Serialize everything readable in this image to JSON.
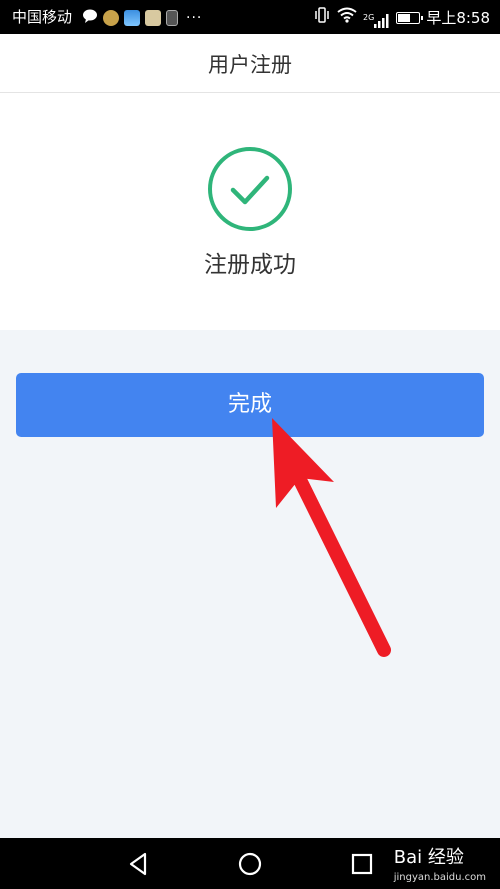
{
  "status_bar": {
    "carrier": "中国移动",
    "left_icons": [
      "message-bubble-icon",
      "app-icon-1",
      "app-icon-2",
      "app-icon-3",
      "sim-icon"
    ],
    "more": "···",
    "network": "2G",
    "time": "早上8:58",
    "battery_level_percent": 60
  },
  "header": {
    "title": "用户注册"
  },
  "success": {
    "icon": "check-circle-icon",
    "message": "注册成功",
    "accent_color": "#2fb57a"
  },
  "done_button": {
    "label": "完成",
    "color": "#4384f0"
  },
  "annotation": {
    "icon": "red-arrow-icon",
    "color": "#ee1c25"
  },
  "nav_bar": {
    "back_icon": "back-triangle-icon",
    "home_icon": "home-circle-icon",
    "recents_icon": "recents-square-icon"
  },
  "watermark": {
    "brand": "Bai 经验",
    "url": "jingyan.baidu.com"
  }
}
